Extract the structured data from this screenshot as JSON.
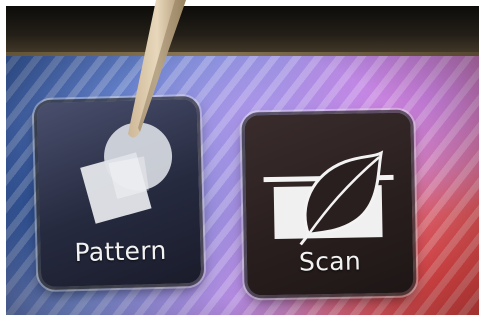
{
  "apps": {
    "pattern": {
      "label": "Pattern",
      "icon": "pattern-icon"
    },
    "scan": {
      "label": "Scan",
      "icon": "leaf-scan-icon"
    }
  },
  "accessories": {
    "stylus": "stylus"
  },
  "colors": {
    "wallpaper_left": "#3c63b0",
    "wallpaper_right": "#e04a3c",
    "wallpaper_top": "#b58ae0",
    "tile_pattern_bg": "#262a3f",
    "tile_scan_bg": "#2a1f1f",
    "label_text": "#f2f2f2"
  }
}
